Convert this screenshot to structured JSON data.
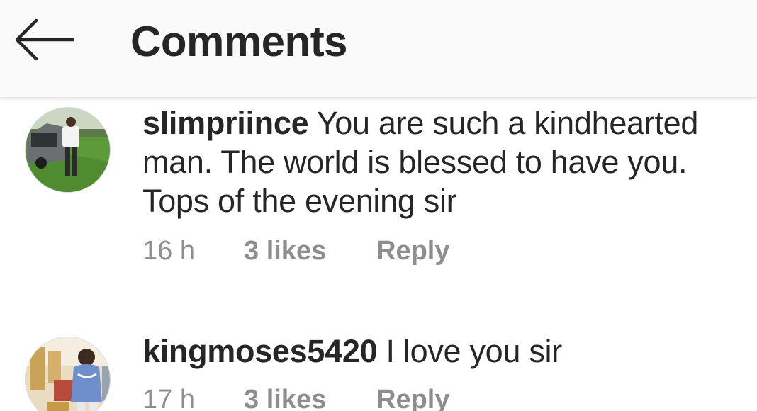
{
  "header": {
    "back_icon": "arrow-left-icon",
    "title": "Comments"
  },
  "comments": [
    {
      "username": "slimpriince",
      "text": "You are such a kindhearted man. The world is blessed to have you. Tops of the evening sir",
      "time": "16 h",
      "likes": "3 likes",
      "reply": "Reply"
    },
    {
      "username": "kingmoses5420",
      "text": "I love you sir",
      "time": "17 h",
      "likes": "3 likes",
      "reply": "Reply"
    }
  ],
  "colors": {
    "text_primary": "#262626",
    "text_secondary": "#8e8e8e",
    "header_bg": "#fafafa"
  }
}
